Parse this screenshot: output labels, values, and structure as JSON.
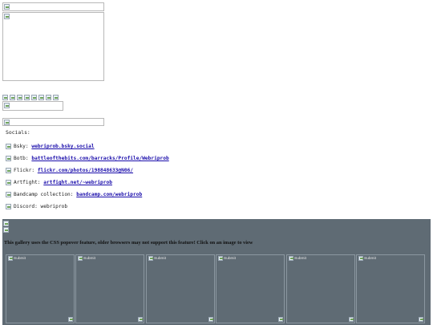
{
  "socials": {
    "title": "Socials:",
    "items": [
      {
        "label": "Bsky:",
        "link": "webriprob.bsky.social"
      },
      {
        "label": "Botb:",
        "link": "battleofthebits.com/barracks/Profile/Webriprob"
      },
      {
        "label": "Flickr:",
        "link": "flickr.com/photos/198848633@N06/"
      },
      {
        "label": "Artfight:",
        "link": "artfight.net/~webriprob"
      },
      {
        "label": "Bandcamp collection:",
        "link": "bandcamp.com/webriprob"
      },
      {
        "label": "Discord: webriprob",
        "link": ""
      }
    ]
  },
  "gallery": {
    "notice": "This gallery uses the CSS popover feature, older browsers may not support this feature! Click on an image to view",
    "tiles": [
      {
        "alt": "Submit"
      },
      {
        "alt": "Submit"
      },
      {
        "alt": "Submit"
      },
      {
        "alt": "Submit"
      },
      {
        "alt": "Submit"
      },
      {
        "alt": "Submit"
      }
    ]
  },
  "colors": {
    "link": "#1a0dab",
    "gallery_bg": "#5f6b74"
  }
}
